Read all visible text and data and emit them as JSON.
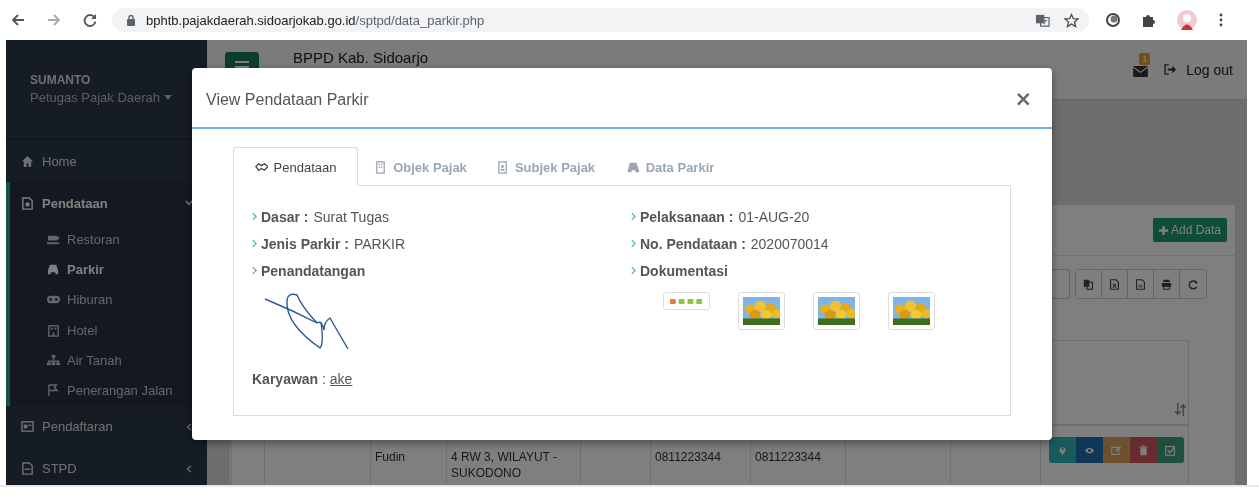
{
  "browser": {
    "url_host": "bphtb.pajakdaerah.sidoarjokab.go.id",
    "url_path": "/sptpd/data_parkir.php"
  },
  "user": {
    "name": "SUMANTO",
    "role": "Petugas Pajak Daerah"
  },
  "sidebar": {
    "items": [
      {
        "label": "Home",
        "selected": false
      },
      {
        "label": "Pendataan",
        "selected": true,
        "expanded": true,
        "children": [
          {
            "label": "Restoran",
            "selected": false
          },
          {
            "label": "Parkir",
            "selected": true
          },
          {
            "label": "Hiburan",
            "selected": false
          },
          {
            "label": "Hotel",
            "selected": false
          },
          {
            "label": "Air Tanah",
            "selected": false
          },
          {
            "label": "Penerangan Jalan",
            "selected": false
          }
        ]
      },
      {
        "label": "Pendaftaran",
        "selected": false,
        "expanded": false
      },
      {
        "label": "STPD",
        "selected": false,
        "expanded": false
      }
    ]
  },
  "header": {
    "title": "BPPD Kab. Sidoarjo",
    "notifications": "1",
    "logout": "Log out"
  },
  "panel": {
    "add_button": "Add Data",
    "row": [
      "Fudin",
      "4 RW 3, WILAYUT - SUKODONO",
      "0811223344",
      "0811223344"
    ]
  },
  "modal": {
    "title": "View Pendataan Parkir",
    "close": "×",
    "tabs": [
      {
        "label": "Pendataan",
        "selected": true
      },
      {
        "label": "Objek Pajak",
        "selected": false
      },
      {
        "label": "Subjek Pajak",
        "selected": false
      },
      {
        "label": "Data Parkir",
        "selected": false
      }
    ],
    "left": [
      {
        "label": "Dasar :",
        "value": "Surat Tugas"
      },
      {
        "label": "Jenis Parkir :",
        "value": "PARKIR"
      },
      {
        "label": "Penandatangan"
      }
    ],
    "right": [
      {
        "label": "Pelaksanaan :",
        "value": "01-AUG-20"
      },
      {
        "label": "No. Pendataan :",
        "value": "2020070014"
      },
      {
        "label": "Dokumentasi"
      }
    ],
    "karyawan": {
      "label": "Karyawan",
      "separator": ":",
      "link": "ake"
    },
    "documents": [
      {
        "kind": "banner"
      },
      {
        "kind": "picture"
      },
      {
        "kind": "picture"
      },
      {
        "kind": "picture"
      }
    ]
  }
}
